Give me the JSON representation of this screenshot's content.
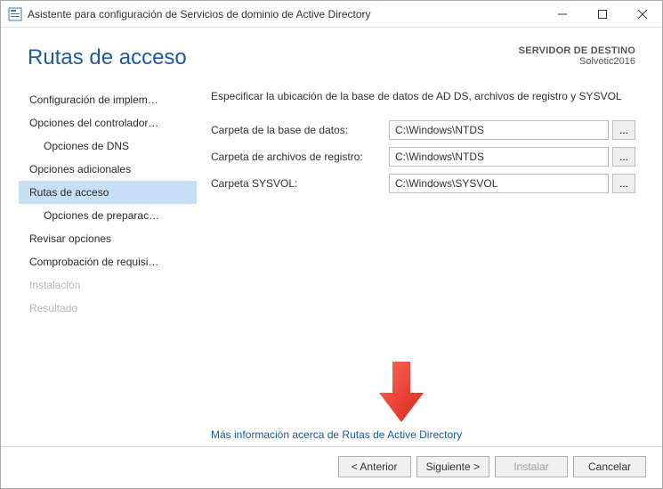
{
  "window": {
    "title": "Asistente para configuración de Servicios de dominio de Active Directory"
  },
  "header": {
    "page_title": "Rutas de acceso",
    "target_label": "SERVIDOR DE DESTINO",
    "target_name": "Solvetic2016"
  },
  "sidebar": {
    "items": [
      {
        "label": "Configuración de implem…",
        "indent": false,
        "selected": false,
        "disabled": false
      },
      {
        "label": "Opciones del controlador…",
        "indent": false,
        "selected": false,
        "disabled": false
      },
      {
        "label": "Opciones de DNS",
        "indent": true,
        "selected": false,
        "disabled": false
      },
      {
        "label": "Opciones adicionales",
        "indent": false,
        "selected": false,
        "disabled": false
      },
      {
        "label": "Rutas de acceso",
        "indent": false,
        "selected": true,
        "disabled": false
      },
      {
        "label": "Opciones de preparac…",
        "indent": true,
        "selected": false,
        "disabled": false
      },
      {
        "label": "Revisar opciones",
        "indent": false,
        "selected": false,
        "disabled": false
      },
      {
        "label": "Comprobación de requisi…",
        "indent": false,
        "selected": false,
        "disabled": false
      },
      {
        "label": "Instalación",
        "indent": false,
        "selected": false,
        "disabled": true
      },
      {
        "label": "Resultado",
        "indent": false,
        "selected": false,
        "disabled": true
      }
    ]
  },
  "main": {
    "instruction": "Especificar la ubicación de la base de datos de AD DS, archivos de registro y SYSVOL",
    "fields": [
      {
        "label": "Carpeta de la base de datos:",
        "value": "C:\\Windows\\NTDS"
      },
      {
        "label": "Carpeta de archivos de registro:",
        "value": "C:\\Windows\\NTDS"
      },
      {
        "label": "Carpeta SYSVOL:",
        "value": "C:\\Windows\\SYSVOL"
      }
    ],
    "browse_label": "...",
    "more_link": "Más información acerca de Rutas de Active Directory"
  },
  "footer": {
    "previous": "< Anterior",
    "next": "Siguiente >",
    "install": "Instalar",
    "cancel": "Cancelar"
  }
}
